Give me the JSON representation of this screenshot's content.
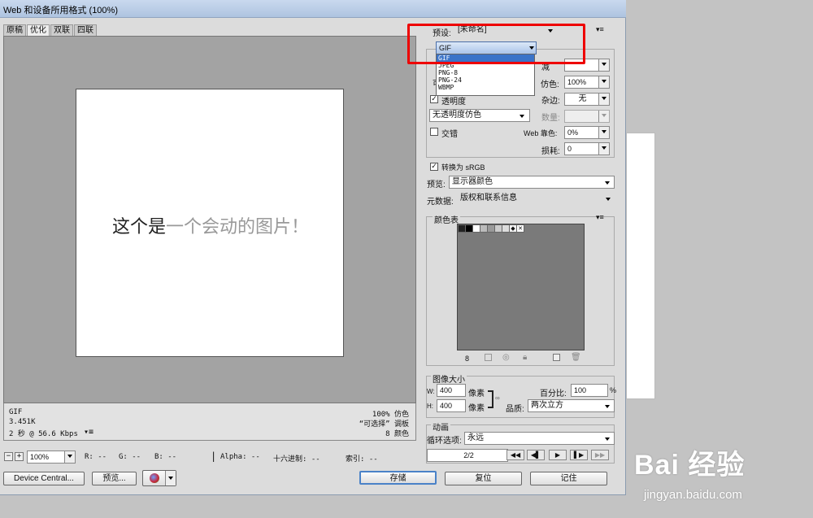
{
  "window": {
    "title": "Web 和设备所用格式 (100%)"
  },
  "tabs": [
    "原稿",
    "优化",
    "双联",
    "四联"
  ],
  "canvas": {
    "image_text_dark": "这个是",
    "image_text_light": "一个会动的图片！"
  },
  "info": {
    "format": "GIF",
    "size": "3.451K",
    "time": "2 秒 @ 56.6 Kbps",
    "dither": "100% 仿色",
    "palette": "“可选择” 调板",
    "colors": "8 颜色"
  },
  "status": {
    "zoom": "100%",
    "r": "R: --",
    "g": "G: --",
    "b": "B: --",
    "alpha": "Alpha: --",
    "hex": "十六进制: --",
    "index": "索引: --"
  },
  "buttons": {
    "device_central": "Device Central...",
    "preview": "预览...",
    "save": "存储",
    "reset": "复位",
    "remember": "记住"
  },
  "panel": {
    "preset_label": "预设:",
    "preset_value": "[未命名]",
    "format_value": "GIF",
    "format_options": [
      "GIF",
      "JPEG",
      "PNG-8",
      "PNG-24",
      "WBMP"
    ],
    "dither_label": "仿色:",
    "dither_value": "100%",
    "transparency_label": "透明度",
    "matte_label": "杂边:",
    "matte_value": "无",
    "trans_dither_value": "无透明度仿色",
    "amount_label": "数量:",
    "interlaced_label": "交错",
    "web_snap_label": "Web 靠色:",
    "web_snap_value": "0%",
    "lossy_label": "损耗:",
    "lossy_value": "0",
    "convert_srgb_label": "转换为 sRGB",
    "preview_label": "预览:",
    "preview_value": "显示器颜色",
    "metadata_label": "元数据:",
    "metadata_value": "版权和联系信息",
    "color_table_label": "颜色表",
    "color_count": "8",
    "image_size_label": "图像大小",
    "w_label": "W:",
    "w_value": "400",
    "h_label": "H:",
    "h_value": "400",
    "px_label": "像素",
    "percent_label": "百分比:",
    "percent_value": "100",
    "percent_sign": "%",
    "quality_label": "品质:",
    "quality_value": "两次立方",
    "animation_label": "动画",
    "loop_label": "循环选项:",
    "loop_value": "永远",
    "frame_counter": "2/2"
  },
  "watermark": {
    "logo": "Bai 经验",
    "url": "jingyan.baidu.com"
  },
  "colors": {
    "highlight": "#e00000",
    "selection": "#3a73c8",
    "color_table_bg": "#7a7a7a",
    "swatches": [
      "#222222",
      "#000000",
      "#ffffff",
      "#bbbbbb",
      "#999999",
      "#cccccc",
      "#dddddd",
      "#f2f2f2"
    ]
  }
}
